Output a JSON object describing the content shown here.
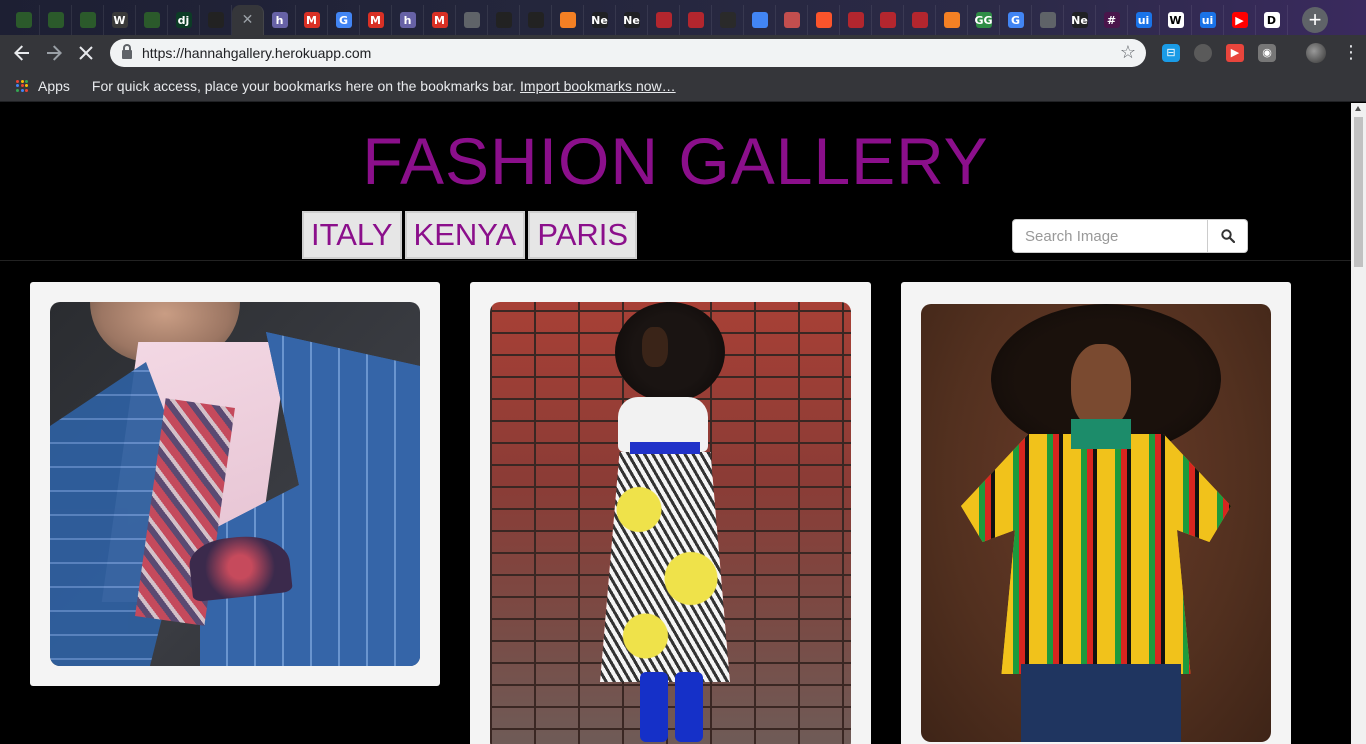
{
  "browser": {
    "tabs": [
      {
        "icon": "tree-icon",
        "color": "#2b5a2b",
        "glyph": ""
      },
      {
        "icon": "tree-icon",
        "color": "#2b5a2b",
        "glyph": ""
      },
      {
        "icon": "tree-icon",
        "color": "#2b5a2b",
        "glyph": ""
      },
      {
        "icon": "w-icon",
        "color": "#3a3a3a",
        "glyph": "W"
      },
      {
        "icon": "tree-icon",
        "color": "#2b5a2b",
        "glyph": ""
      },
      {
        "icon": "django-icon",
        "color": "#0c3c26",
        "glyph": "dj"
      },
      {
        "icon": "github-icon",
        "color": "#222222",
        "glyph": ""
      },
      {
        "icon": "close-icon",
        "color": "#9aa0a6",
        "glyph": "✕",
        "active": true
      },
      {
        "icon": "heroku-icon",
        "color": "#6762a6",
        "glyph": "h"
      },
      {
        "icon": "gmail-icon",
        "color": "#d93025",
        "glyph": "M"
      },
      {
        "icon": "google-icon",
        "color": "#4285f4",
        "glyph": "G"
      },
      {
        "icon": "gmail-icon",
        "color": "#d93025",
        "glyph": "M"
      },
      {
        "icon": "heroku-icon",
        "color": "#6762a6",
        "glyph": "h"
      },
      {
        "icon": "gmail-icon",
        "color": "#d93025",
        "glyph": "M"
      },
      {
        "icon": "document-icon",
        "color": "#5f6368",
        "glyph": ""
      },
      {
        "icon": "github-icon",
        "color": "#222222",
        "glyph": ""
      },
      {
        "icon": "github-icon",
        "color": "#222222",
        "glyph": ""
      },
      {
        "icon": "stackoverflow-icon",
        "color": "#f48024",
        "glyph": ""
      },
      {
        "icon": "ne-icon",
        "color": "#202124",
        "glyph": "Ne"
      },
      {
        "icon": "ne-icon",
        "color": "#202124",
        "glyph": "Ne"
      },
      {
        "icon": "red-logo-icon",
        "color": "#b3262e",
        "glyph": ""
      },
      {
        "icon": "red-logo-icon",
        "color": "#b3262e",
        "glyph": ""
      },
      {
        "icon": "dark-icon",
        "color": "#2a2a2a",
        "glyph": ""
      },
      {
        "icon": "chrome-icon",
        "color": "#4285f4",
        "glyph": ""
      },
      {
        "icon": "store-icon",
        "color": "#c24e4e",
        "glyph": ""
      },
      {
        "icon": "brave-icon",
        "color": "#fb542b",
        "glyph": ""
      },
      {
        "icon": "red-logo-icon",
        "color": "#b3262e",
        "glyph": ""
      },
      {
        "icon": "red-logo-icon",
        "color": "#b3262e",
        "glyph": ""
      },
      {
        "icon": "red-logo-icon",
        "color": "#b3262e",
        "glyph": ""
      },
      {
        "icon": "stackoverflow-icon",
        "color": "#f48024",
        "glyph": ""
      },
      {
        "icon": "gfg-icon",
        "color": "#2f8d46",
        "glyph": "GG"
      },
      {
        "icon": "google-icon",
        "color": "#4285f4",
        "glyph": "G"
      },
      {
        "icon": "document-icon",
        "color": "#5f6368",
        "glyph": ""
      },
      {
        "icon": "ne-icon",
        "color": "#202124",
        "glyph": "Ne"
      },
      {
        "icon": "hash-icon",
        "color": "#4a154b",
        "glyph": "#"
      },
      {
        "icon": "ui-icon",
        "color": "#1a73e8",
        "glyph": "ui"
      },
      {
        "icon": "wikipedia-icon",
        "color": "#ffffff",
        "glyph": "W"
      },
      {
        "icon": "ui-icon",
        "color": "#1a73e8",
        "glyph": "ui"
      },
      {
        "icon": "youtube-icon",
        "color": "#ff0000",
        "glyph": "▶"
      },
      {
        "icon": "d-icon",
        "color": "#ffffff",
        "glyph": "D"
      }
    ],
    "url": "https://hannahgallery.herokuapp.com",
    "bookmarks": {
      "apps_label": "Apps",
      "hint": "For quick access, place your bookmarks here on the bookmarks bar.",
      "import_link": "Import bookmarks now…"
    }
  },
  "site": {
    "title": "FASHION GALLERY",
    "accent": "#8b0f8b",
    "nav": [
      "ITALY",
      "KENYA",
      "PARIS"
    ],
    "search_placeholder": "Search Image"
  },
  "gallery": [
    {
      "subject": "blue plaid suit with pocket square"
    },
    {
      "subject": "woman in African print skirt against brick wall"
    },
    {
      "subject": "woman in kente peplum top"
    }
  ]
}
